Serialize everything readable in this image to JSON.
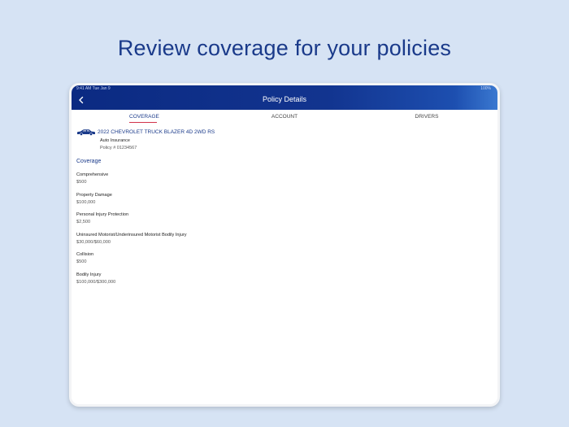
{
  "headline": "Review coverage for your policies",
  "status_bar": {
    "left": "9:41 AM   Tue Jan 9",
    "right": "100%"
  },
  "nav": {
    "title": "Policy Details"
  },
  "tabs": [
    {
      "label": "COVERAGE",
      "active": true
    },
    {
      "label": "ACCOUNT",
      "active": false
    },
    {
      "label": "DRIVERS",
      "active": false
    }
  ],
  "vehicle": {
    "title": "2022 CHEVROLET TRUCK BLAZER 4D 2WD RS",
    "type": "Auto Insurance",
    "policy": "Policy # 01234567"
  },
  "coverage_heading": "Coverage",
  "coverages": [
    {
      "name": "Comprehensive",
      "value": "$500"
    },
    {
      "name": "Property Damage",
      "value": "$100,000"
    },
    {
      "name": "Personal Injury Protection",
      "value": "$2,500"
    },
    {
      "name": "Uninsured Motorist/Underinsured Motorist Bodily Injury",
      "value": "$30,000/$60,000"
    },
    {
      "name": "Collision",
      "value": "$500"
    },
    {
      "name": "Bodily Injury",
      "value": "$100,000/$300,000"
    }
  ],
  "colors": {
    "accent": "#1a3a8a",
    "tab_indicator": "#d2334a",
    "background": "#d6e3f4"
  }
}
